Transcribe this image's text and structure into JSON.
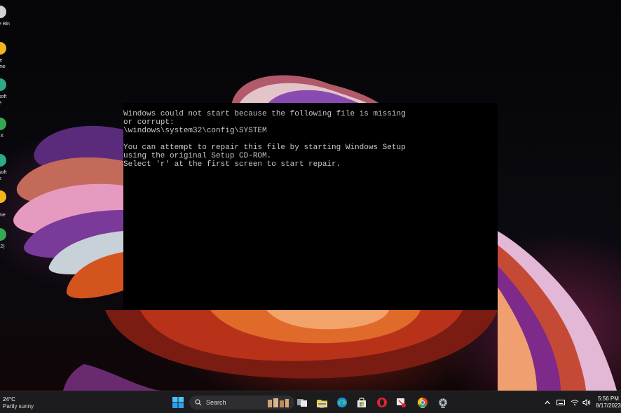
{
  "desktop": {
    "icons": [
      {
        "label": "e Bin",
        "icon": "recycle-bin-icon",
        "color": "#cfd3d8"
      },
      {
        "label": "le\nme",
        "icon": "chrome-icon",
        "color": "#f2b61c"
      },
      {
        "label": "soft\ne",
        "icon": "edge-icon",
        "color": "#2ea98a"
      },
      {
        "label": "-X",
        "icon": "app-icon",
        "color": "#33a852"
      },
      {
        "label": "soft\ne",
        "icon": "edge-icon",
        "color": "#2ea98a"
      },
      {
        "label": "-\nme",
        "icon": "chrome-icon",
        "color": "#f2b61c"
      },
      {
        "label": "(2)",
        "icon": "chrome-icon",
        "color": "#34a853"
      }
    ]
  },
  "error_screen": {
    "lines": [
      "Windows could not start because the following file is missing",
      "or corrupt:",
      "\\windows\\system32\\config\\SYSTEM",
      "",
      "You can attempt to repair this file by starting Windows Setup",
      "using the original Setup CD-ROM.",
      "Select 'r' at the first screen to start repair."
    ]
  },
  "taskbar": {
    "weather": {
      "temp": "24°C",
      "condition": "Partly sunny"
    },
    "search_label": "Search",
    "apps": [
      {
        "name": "task-view-icon"
      },
      {
        "name": "file-explorer-icon"
      },
      {
        "name": "edge-icon"
      },
      {
        "name": "microsoft-store-icon"
      },
      {
        "name": "opera-icon"
      },
      {
        "name": "snipping-tool-icon"
      },
      {
        "name": "chrome-icon"
      },
      {
        "name": "settings-icon"
      }
    ],
    "tray": [
      "chevron-up-icon",
      "keyboard-icon",
      "wifi-icon",
      "volume-icon"
    ],
    "clock": {
      "time": "5:56 PM",
      "date": "8/17/2023"
    },
    "accent": "#0078d4"
  }
}
